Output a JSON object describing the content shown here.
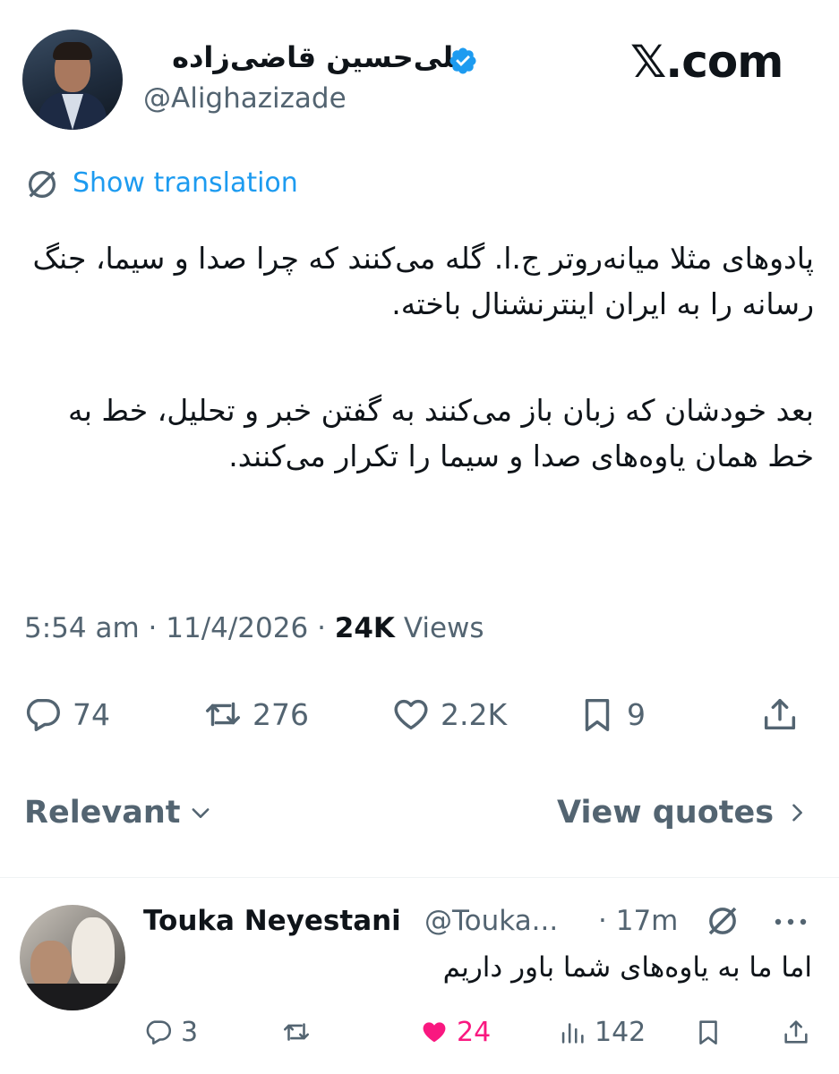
{
  "brand": "𝕏.com",
  "tweet": {
    "author_name": "علی‌حسین قاضی‌زاده",
    "author_handle": "@Alighazizade",
    "show_translation": "Show translation",
    "paragraph1": "پادوهای مثلا میانه‌روتر ج.ا. گله می‌کنند که چرا صدا و سیما، جنگ رسانه را به ایران اینترنشنال باخته.",
    "paragraph2": "بعد خودشان که زبان باز می‌کنند به گفتن خبر و تحلیل، خط به خط همان یاوه‌های صدا و سیما را تکرار می‌کنند.",
    "time": "5:54 am",
    "date": "11/4/2026",
    "views_count": "24K",
    "views_label": "Views",
    "reply_count": "74",
    "retweet_count": "276",
    "like_count": "2.2K",
    "bookmark_count": "9"
  },
  "sort": {
    "label": "Relevant",
    "quotes_label": "View quotes"
  },
  "reply": {
    "name": "Touka Neyestani",
    "handle": "@Touka...",
    "time": "17m",
    "text": "اما ما به یاوه‌های شما باور داریم",
    "reply_count": "3",
    "like_count": "24",
    "views_count": "142"
  },
  "colors": {
    "accent": "#1d9bf0",
    "muted": "#536471",
    "like": "#f91880"
  }
}
